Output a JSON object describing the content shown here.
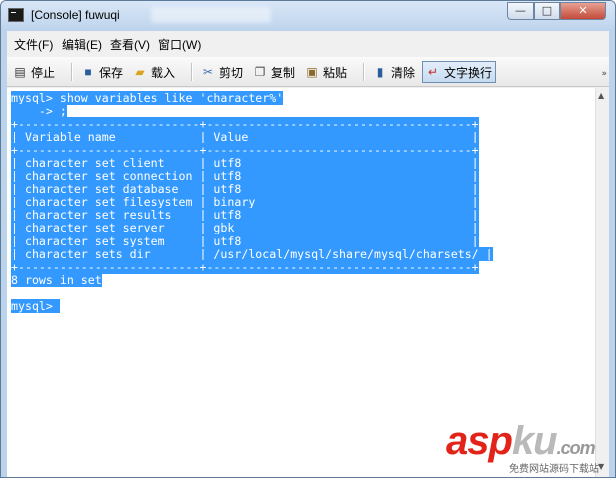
{
  "window": {
    "title": "[Console] fuwuqi",
    "minimize": "—",
    "maximize": "□",
    "close": "✕"
  },
  "menu": [
    {
      "label": "文件(F)",
      "underline": "F"
    },
    {
      "label": "编辑(E)",
      "underline": "E"
    },
    {
      "label": "查看(V)",
      "underline": "V"
    },
    {
      "label": "窗口(W)",
      "underline": "W"
    }
  ],
  "toolbar": {
    "stop": {
      "label": "停止",
      "icon": "stop-icon"
    },
    "save": {
      "label": "保存",
      "icon": "save-icon"
    },
    "load": {
      "label": "载入",
      "icon": "folder-icon"
    },
    "cut": {
      "label": "剪切",
      "icon": "scissors-icon"
    },
    "copy": {
      "label": "复制",
      "icon": "copy-icon"
    },
    "paste": {
      "label": "粘贴",
      "icon": "paste-icon"
    },
    "clear": {
      "label": "清除",
      "icon": "trash-icon"
    },
    "wrap": {
      "label": "文字换行",
      "icon": "wordwrap-icon",
      "active": true
    }
  },
  "console": {
    "lines": [
      {
        "text": "mysql> show variables like 'character%'",
        "selected": true
      },
      {
        "text": "    -> ;",
        "selected": true
      },
      {
        "text": "+--------------------------+--------------------------------------+",
        "selected": true
      },
      {
        "text": "| Variable_name            | Value                                |",
        "selected": true
      },
      {
        "text": "+--------------------------+--------------------------------------+",
        "selected": true
      },
      {
        "text": "| character_set_client     | utf8                                 |",
        "selected": true
      },
      {
        "text": "| character_set_connection | utf8                                 |",
        "selected": true
      },
      {
        "text": "| character_set_database   | utf8                                 |",
        "selected": true
      },
      {
        "text": "| character_set_filesystem | binary                               |",
        "selected": true
      },
      {
        "text": "| character_set_results    | utf8                                 |",
        "selected": true
      },
      {
        "text": "| character_set_server     | gbk                                  |",
        "selected": true
      },
      {
        "text": "| character_set_system     | utf8                                 |",
        "selected": true
      },
      {
        "text": "| character_sets_dir       | /usr/local/mysql/share/mysql/charsets/ |",
        "selected": true
      },
      {
        "text": "+--------------------------+--------------------------------------+",
        "selected": true
      },
      {
        "text": "8 rows in set",
        "selected": true
      },
      {
        "text": "",
        "selected": false
      },
      {
        "text": "mysql> ",
        "selected": true
      }
    ],
    "selection_color": "#3399ff"
  },
  "watermark": {
    "brand_a": "asp",
    "brand_b": "ku",
    "brand_c": ".com",
    "sub": "免费网站源码下载站"
  }
}
